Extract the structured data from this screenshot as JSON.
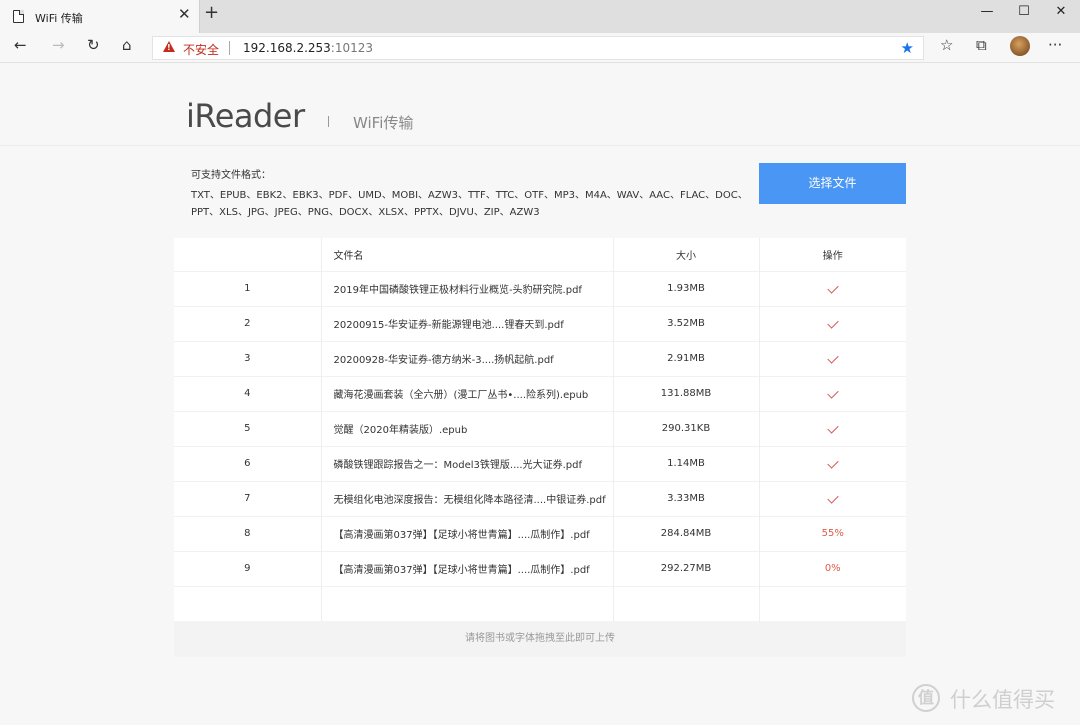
{
  "browser": {
    "tab_title": "WiFi 传输",
    "tab_close": "✕",
    "new_tab": "+",
    "window_controls": {
      "minimize": "—",
      "maximize": "☐",
      "close": "✕"
    },
    "nav": {
      "back": "←",
      "forward": "→",
      "refresh": "↻",
      "home": "⌂"
    },
    "security_label": "不安全",
    "url_host": "192.168.2.253",
    "url_port": ":10123",
    "toolbar_icons": {
      "star": "★",
      "favorites": "☆",
      "collections": "⧉",
      "more": "···"
    }
  },
  "header": {
    "logo": "iReader",
    "subtitle": "WiFi传输"
  },
  "formats": {
    "label": "可支持文件格式：",
    "list": "TXT、EPUB、EBK2、EBK3、PDF、UMD、MOBI、AZW3、TTF、TTC、OTF、MP3、M4A、WAV、AAC、FLAC、DOC、PPT、XLS、JPG、JPEG、PNG、DOCX、XLSX、PPTX、DJVU、ZIP、AZW3"
  },
  "select_button": "选择文件",
  "table": {
    "headers": {
      "index": "",
      "name": "文件名",
      "size": "大小",
      "action": "操作"
    },
    "rows": [
      {
        "index": "1",
        "name": "2019年中国磷酸铁锂正极材料行业概览-头豹研究院.pdf",
        "size": "1.93MB",
        "status": "done"
      },
      {
        "index": "2",
        "name": "20200915-华安证券-新能源锂电池....锂春天到.pdf",
        "size": "3.52MB",
        "status": "done"
      },
      {
        "index": "3",
        "name": "20200928-华安证券-德方纳米-3....扬帆起航.pdf",
        "size": "2.91MB",
        "status": "done"
      },
      {
        "index": "4",
        "name": "藏海花漫画套装（全六册）(漫工厂丛书•....险系列).epub",
        "size": "131.88MB",
        "status": "done"
      },
      {
        "index": "5",
        "name": "觉醒（2020年精装版）.epub",
        "size": "290.31KB",
        "status": "done"
      },
      {
        "index": "6",
        "name": "磷酸铁锂跟踪报告之一：Model3铁锂版....光大证券.pdf",
        "size": "1.14MB",
        "status": "done"
      },
      {
        "index": "7",
        "name": "无模组化电池深度报告：无模组化降本路径清....中银证券.pdf",
        "size": "3.33MB",
        "status": "done"
      },
      {
        "index": "8",
        "name": "【高清漫画第037弹】【足球小将世青篇】....瓜制作】.pdf",
        "size": "284.84MB",
        "status": "55%"
      },
      {
        "index": "9",
        "name": "【高清漫画第037弹】【足球小将世青篇】....瓜制作】.pdf",
        "size": "292.27MB",
        "status": "0%"
      }
    ]
  },
  "drop_hint": "请将图书或字体拖拽至此即可上传",
  "watermark": {
    "mark": "值",
    "text": "什么值得买"
  },
  "colors": {
    "button": "#4a96f5",
    "check": "#d9534f",
    "progress": "#e05a4a",
    "security": "#c42b1c"
  }
}
